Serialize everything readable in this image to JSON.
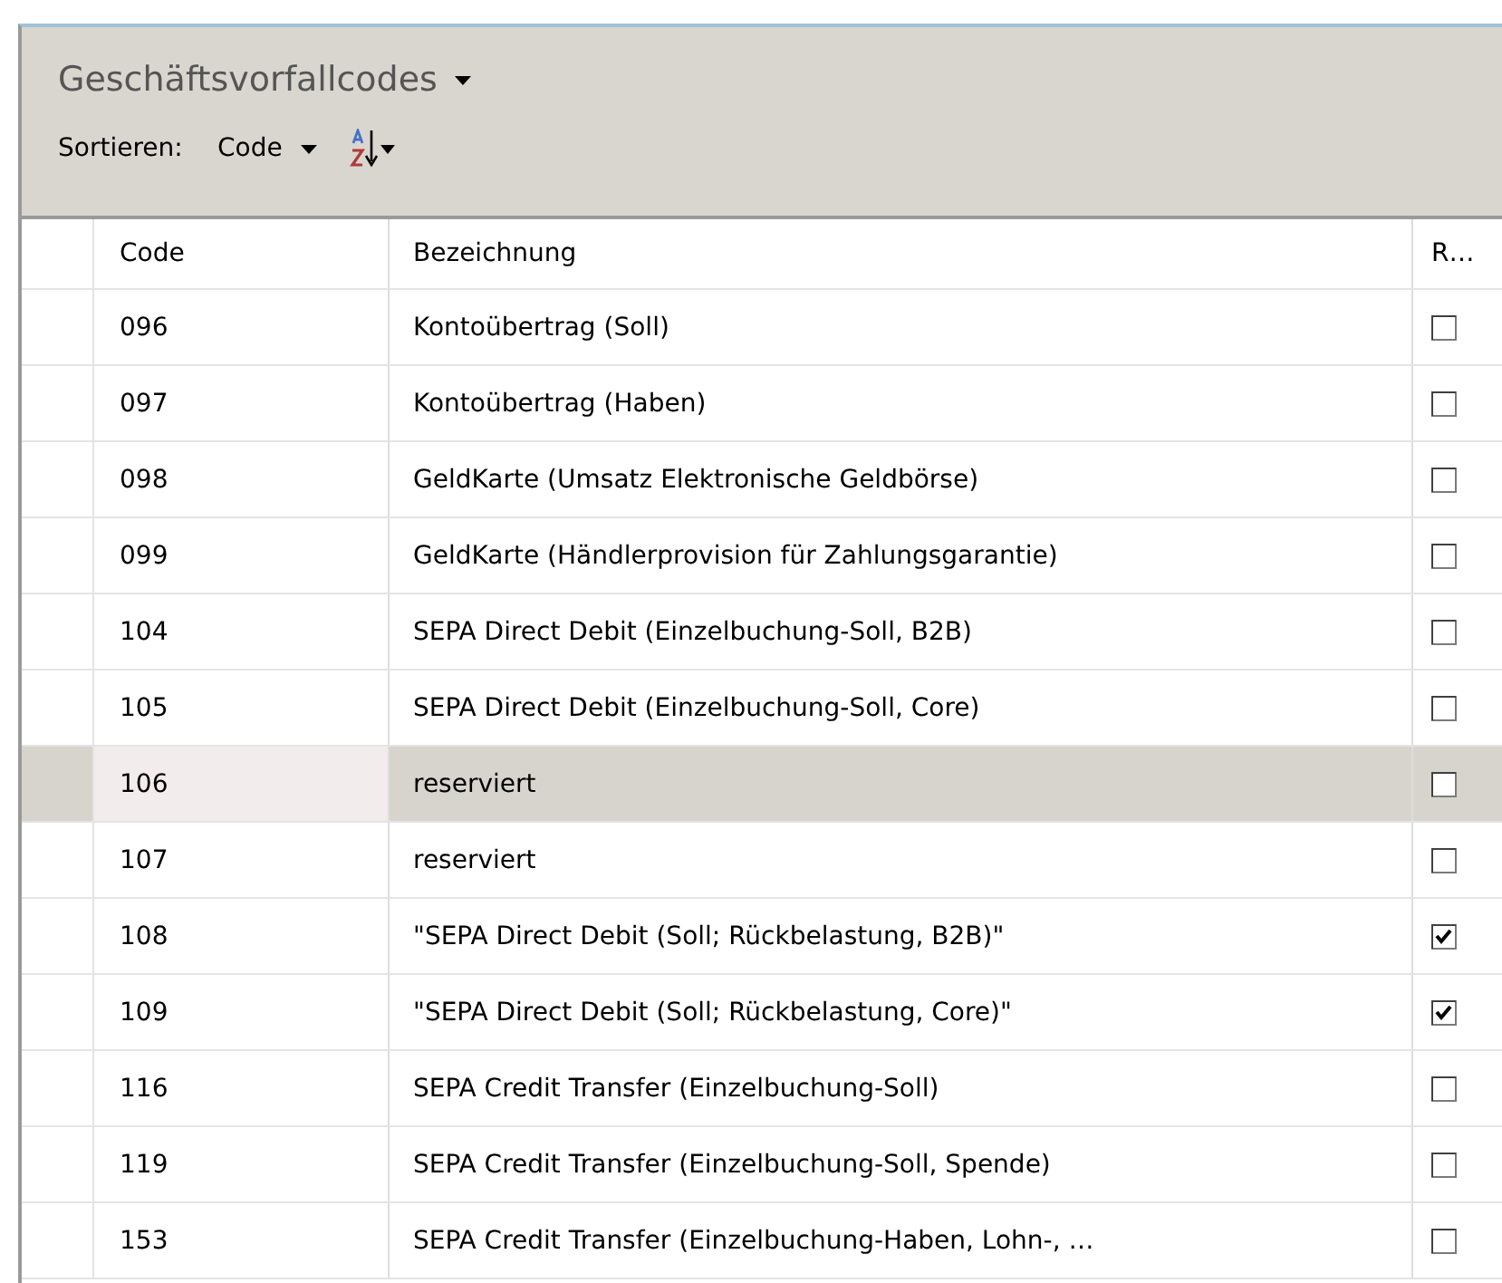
{
  "title": "Geschäftsvorfallcodes",
  "sort": {
    "label": "Sortieren:",
    "field": "Code"
  },
  "table": {
    "columns": [
      "Code",
      "Bezeichnung",
      "R…"
    ],
    "rows": [
      {
        "code": "096",
        "name": "Kontoübertrag (Soll)",
        "checked": false,
        "selected": false
      },
      {
        "code": "097",
        "name": "Kontoübertrag (Haben)",
        "checked": false,
        "selected": false
      },
      {
        "code": "098",
        "name": "GeldKarte (Umsatz Elektronische Geldbörse)",
        "checked": false,
        "selected": false
      },
      {
        "code": "099",
        "name": "GeldKarte (Händlerprovision für Zahlungsgarantie)",
        "checked": false,
        "selected": false
      },
      {
        "code": "104",
        "name": "SEPA Direct Debit (Einzelbuchung-Soll, B2B)",
        "checked": false,
        "selected": false
      },
      {
        "code": "105",
        "name": "SEPA Direct Debit (Einzelbuchung-Soll, Core)",
        "checked": false,
        "selected": false
      },
      {
        "code": "106",
        "name": "reserviert",
        "checked": false,
        "selected": true
      },
      {
        "code": "107",
        "name": "reserviert",
        "checked": false,
        "selected": false
      },
      {
        "code": "108",
        "name": "\"SEPA Direct Debit (Soll; Rückbelastung, B2B)\"",
        "checked": true,
        "selected": false
      },
      {
        "code": "109",
        "name": "\"SEPA Direct Debit (Soll; Rückbelastung, Core)\"",
        "checked": true,
        "selected": false
      },
      {
        "code": "116",
        "name": "SEPA Credit Transfer (Einzelbuchung-Soll)",
        "checked": false,
        "selected": false
      },
      {
        "code": "119",
        "name": "SEPA Credit Transfer (Einzelbuchung-Soll, Spende)",
        "checked": false,
        "selected": false
      },
      {
        "code": "153",
        "name": "SEPA Credit Transfer (Einzelbuchung-Haben, Lohn-, …",
        "checked": false,
        "selected": false
      }
    ]
  }
}
